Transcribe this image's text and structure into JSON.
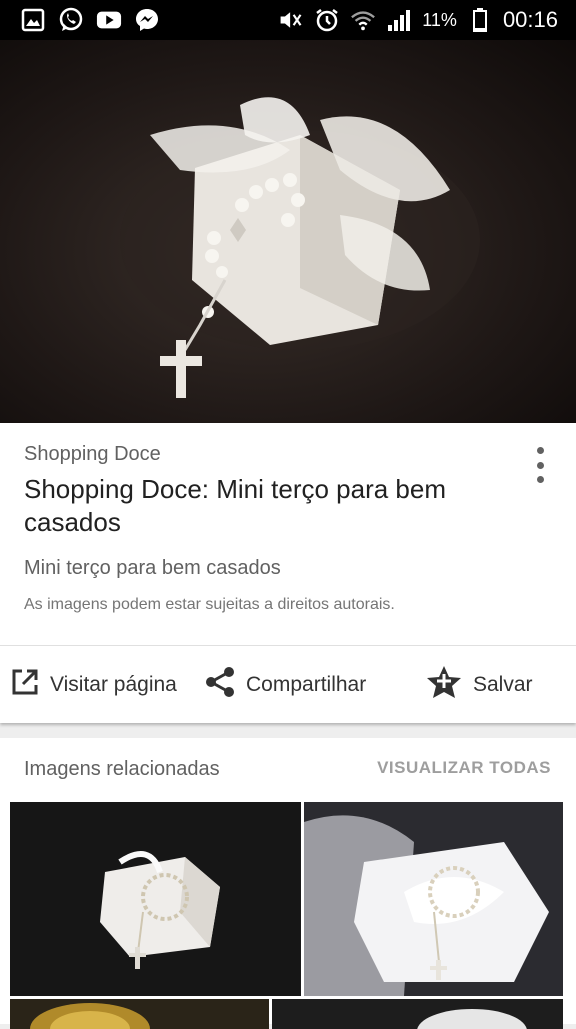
{
  "status_bar": {
    "battery": "11%",
    "time": "00:16"
  },
  "result": {
    "source": "Shopping Doce",
    "title": "Shopping Doce: Mini terço para bem casados",
    "subtitle": "Mini terço para bem casados",
    "copyright_note": "As imagens podem estar sujeitas a direitos autorais."
  },
  "actions": {
    "visit": "Visitar página",
    "share": "Compartilhar",
    "save": "Salvar"
  },
  "related": {
    "title": "Imagens relacionadas",
    "view_all": "VISUALIZAR TODAS",
    "thumbnails": [
      "related-image-1",
      "related-image-2",
      "related-image-3",
      "related-image-4"
    ]
  },
  "icons": [
    "gallery-icon",
    "whatsapp-icon",
    "youtube-icon",
    "messenger-icon",
    "mute-icon",
    "alarm-icon",
    "wifi-icon",
    "signal-icon",
    "battery-icon",
    "open-external-icon",
    "share-icon",
    "save-star-icon",
    "more-vert-icon"
  ]
}
